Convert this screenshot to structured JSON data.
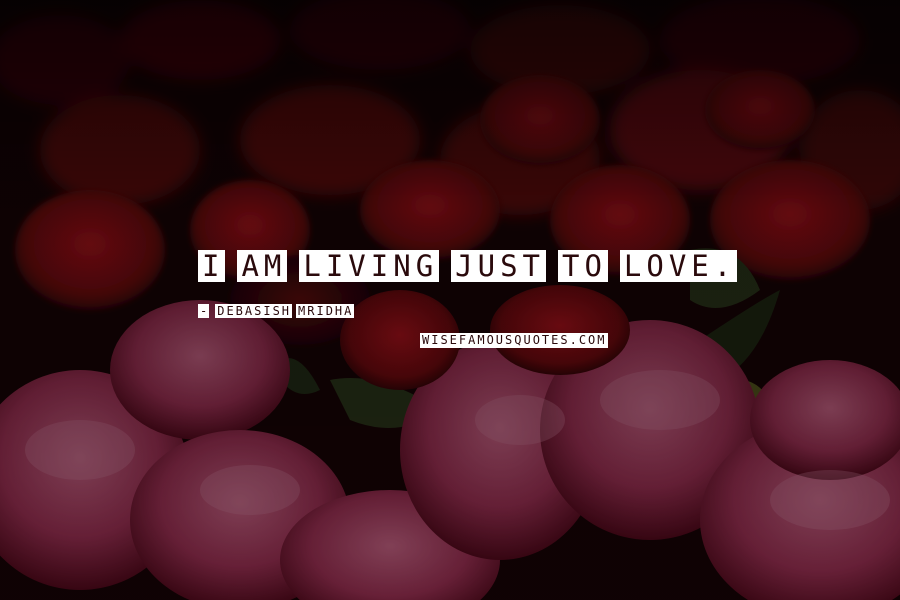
{
  "quote": {
    "words": [
      "I",
      "AM",
      "LIVING",
      "JUST",
      "TO",
      "LOVE."
    ]
  },
  "author": {
    "dash": "-",
    "name_parts": [
      "DEBASISH",
      "MRIDHA"
    ]
  },
  "site": {
    "label": "WISEFAMOUSQUOTES.COM"
  },
  "colors": {
    "background": "#1a0306",
    "petal_red": "#8a0c14",
    "petal_pink": "#a8345a",
    "leaf_green": "#2f3a1c",
    "text_box": "#ffffff",
    "text_ink": "#2a0a0c"
  }
}
